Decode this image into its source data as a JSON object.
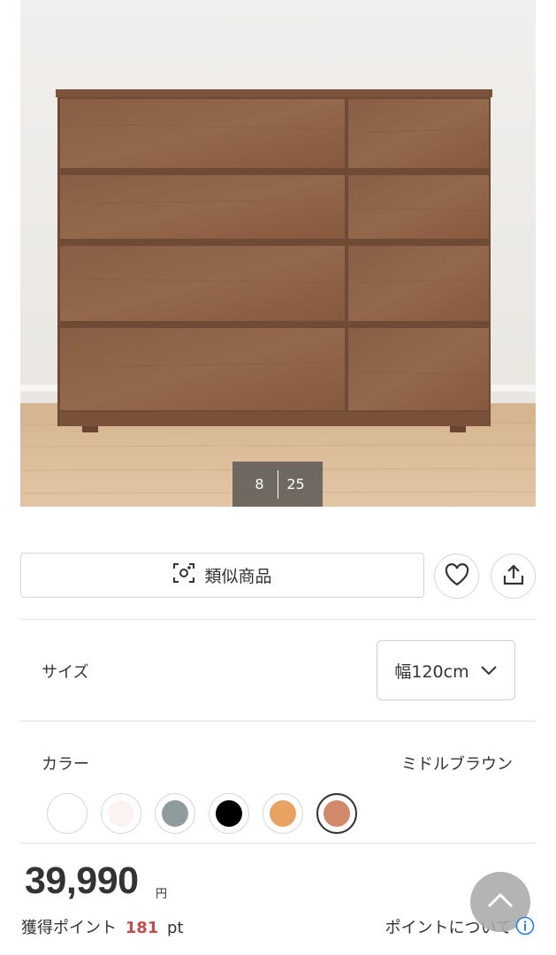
{
  "gallery": {
    "current": "8",
    "total": "25"
  },
  "actions": {
    "similar_label": "類似商品",
    "similar_icon": "camera-scan-icon",
    "favorite_icon": "heart-icon",
    "share_icon": "share-icon"
  },
  "size": {
    "label": "サイズ",
    "selected": "幅120cm",
    "dropdown_icon": "chevron-down-icon"
  },
  "color": {
    "label": "カラー",
    "selected_name": "ミドルブラウン",
    "swatches": [
      {
        "color": "#ffffff",
        "selected": false
      },
      {
        "color": "#fbf3f1",
        "selected": false
      },
      {
        "color": "#8f9b9d",
        "selected": false
      },
      {
        "color": "#000000",
        "selected": false
      },
      {
        "color": "#e8a362",
        "selected": false
      },
      {
        "color": "#d38a6a",
        "selected": true
      }
    ]
  },
  "price": {
    "amount": "39,990",
    "currency": "円"
  },
  "points": {
    "label": "獲得ポイント",
    "value": "181",
    "unit": "pt",
    "about_label": "ポイントについて",
    "info_icon": "info-icon"
  },
  "scroll_top_icon": "chevron-up-icon",
  "colors": {
    "accent_red": "#c0504d",
    "info_blue": "#2b7de9"
  }
}
